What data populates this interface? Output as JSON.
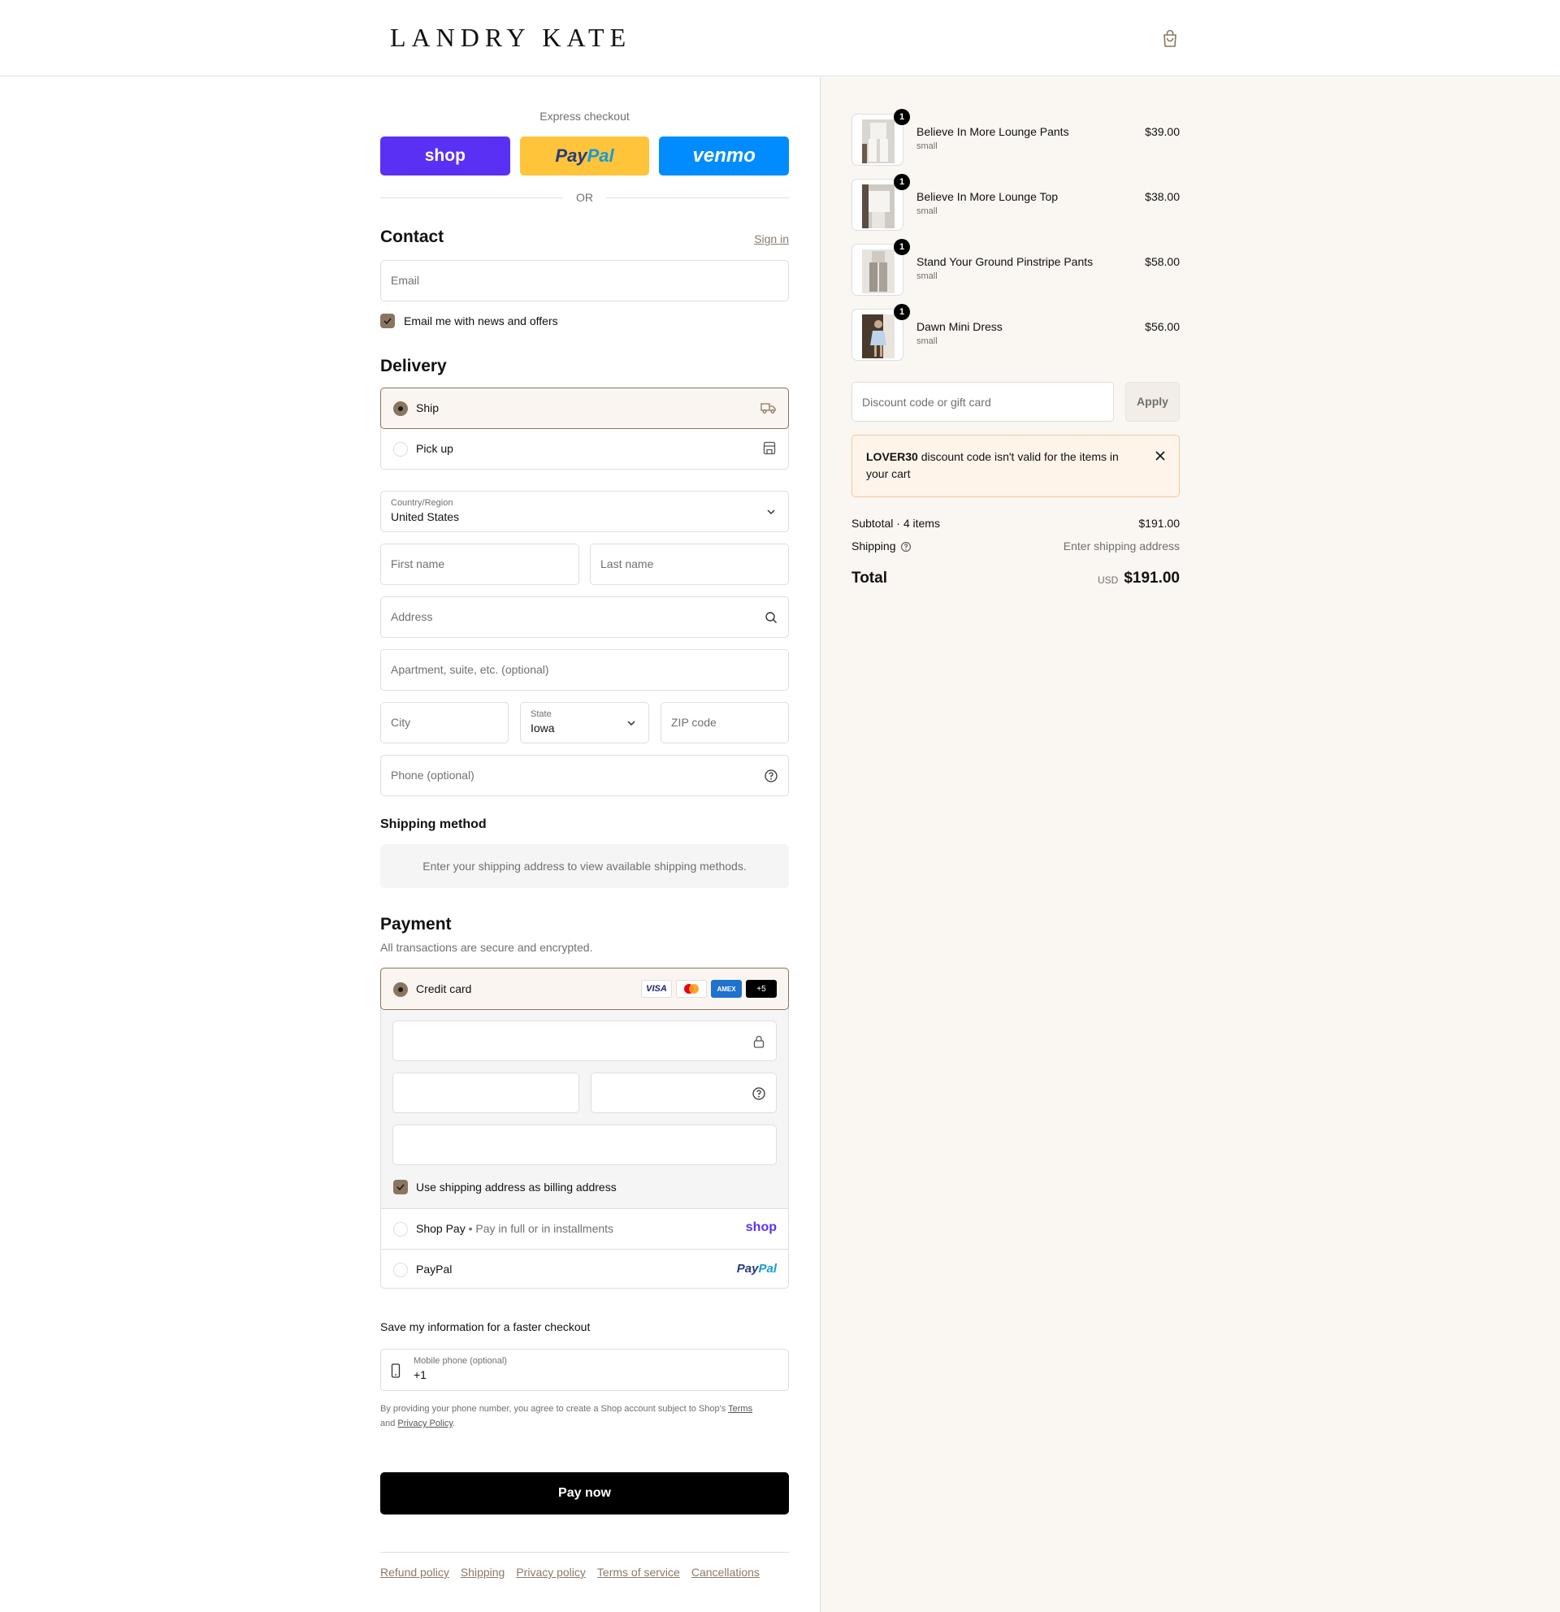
{
  "header": {
    "brand": "LANDRY KATE"
  },
  "express": {
    "label": "Express checkout",
    "shop_label": "shop",
    "paypal_label_1": "Pay",
    "paypal_label_2": "Pal",
    "venmo_label": "venmo",
    "or_label": "OR"
  },
  "contact": {
    "title": "Contact",
    "signin_label": "Sign in",
    "email_placeholder": "Email",
    "newsletter_label": "Email me with news and offers",
    "newsletter_checked": true
  },
  "delivery": {
    "title": "Delivery",
    "options": [
      {
        "label": "Ship",
        "selected": true,
        "icon": "truck-icon"
      },
      {
        "label": "Pick up",
        "selected": false,
        "icon": "store-icon"
      }
    ],
    "country_label": "Country/Region",
    "country_value": "United States",
    "first_name_placeholder": "First name",
    "last_name_placeholder": "Last name",
    "address_placeholder": "Address",
    "apartment_placeholder": "Apartment, suite, etc. (optional)",
    "city_placeholder": "City",
    "state_label": "State",
    "state_value": "Iowa",
    "zip_placeholder": "ZIP code",
    "phone_placeholder": "Phone (optional)"
  },
  "shipping_method": {
    "title": "Shipping method",
    "notice": "Enter your shipping address to view available shipping methods."
  },
  "payment": {
    "title": "Payment",
    "subtitle": "All transactions are secure and encrypted.",
    "credit_card_label": "Credit card",
    "card_brands": [
      "VISA",
      "",
      "AMEX",
      "+5"
    ],
    "billing_same_label": "Use shipping address as billing address",
    "shoppay_label": "Shop Pay",
    "shoppay_sub": "Pay in full or in installments",
    "shoppay_logo": "shop",
    "paypal_label": "PayPal",
    "paypal_logo_1": "Pay",
    "paypal_logo_2": "Pal"
  },
  "save_info": {
    "title": "Save my information for a faster checkout",
    "mobile_label": "Mobile phone (optional)",
    "mobile_value": "+1",
    "legal_1": "By providing your phone number, you agree to create a Shop account subject to Shop's ",
    "legal_terms": "Terms",
    "legal_2": "and ",
    "legal_privacy": "Privacy Policy",
    "legal_3": "."
  },
  "pay_now_label": "Pay now",
  "footer_links": [
    "Refund policy",
    "Shipping",
    "Privacy policy",
    "Terms of service",
    "Cancellations"
  ],
  "cart": {
    "items": [
      {
        "name": "Believe In More Lounge Pants",
        "variant": "small",
        "price": "$39.00",
        "qty": "1"
      },
      {
        "name": "Believe In More Lounge Top",
        "variant": "small",
        "price": "$38.00",
        "qty": "1"
      },
      {
        "name": "Stand Your Ground Pinstripe Pants",
        "variant": "small",
        "price": "$58.00",
        "qty": "1"
      },
      {
        "name": "Dawn Mini Dress",
        "variant": "small",
        "price": "$56.00",
        "qty": "1"
      }
    ],
    "discount_placeholder": "Discount code or gift card",
    "apply_label": "Apply",
    "alert_code": "LOVER30",
    "alert_text": " discount code isn't valid for the items in your cart",
    "subtotal_label": "Subtotal · 4 items",
    "subtotal_value": "$191.00",
    "shipping_label": "Shipping",
    "shipping_value": "Enter shipping address",
    "total_label": "Total",
    "total_currency": "USD",
    "total_value": "$191.00"
  },
  "colors": {
    "accent": "#8a7660",
    "shop_purple": "#5a31f4",
    "paypal_yellow": "#ffc439",
    "venmo_blue": "#008cff",
    "summary_bg": "#faf6f1"
  }
}
